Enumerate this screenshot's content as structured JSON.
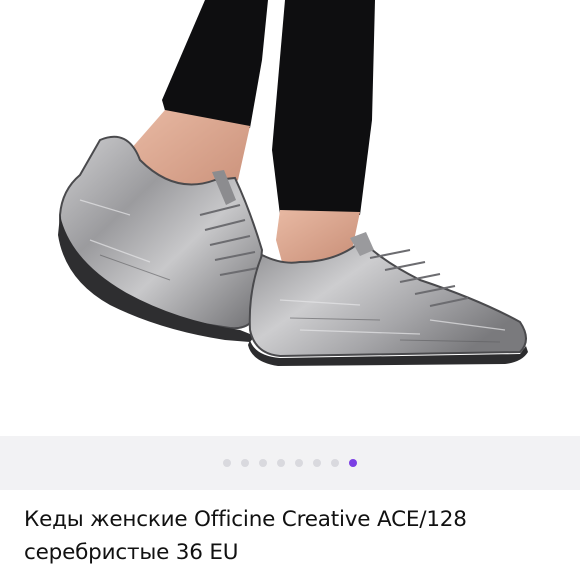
{
  "product": {
    "title": "Кеды женские Officine Creative ACE/128 серебристые 36 EU"
  },
  "gallery": {
    "image": "product-photo-silver-sneakers",
    "total_images": 8,
    "active_index": 7
  },
  "colors": {
    "accent": "#7b3fe4",
    "dot_inactive": "#d9d9de",
    "dots_background": "#f2f2f4"
  }
}
